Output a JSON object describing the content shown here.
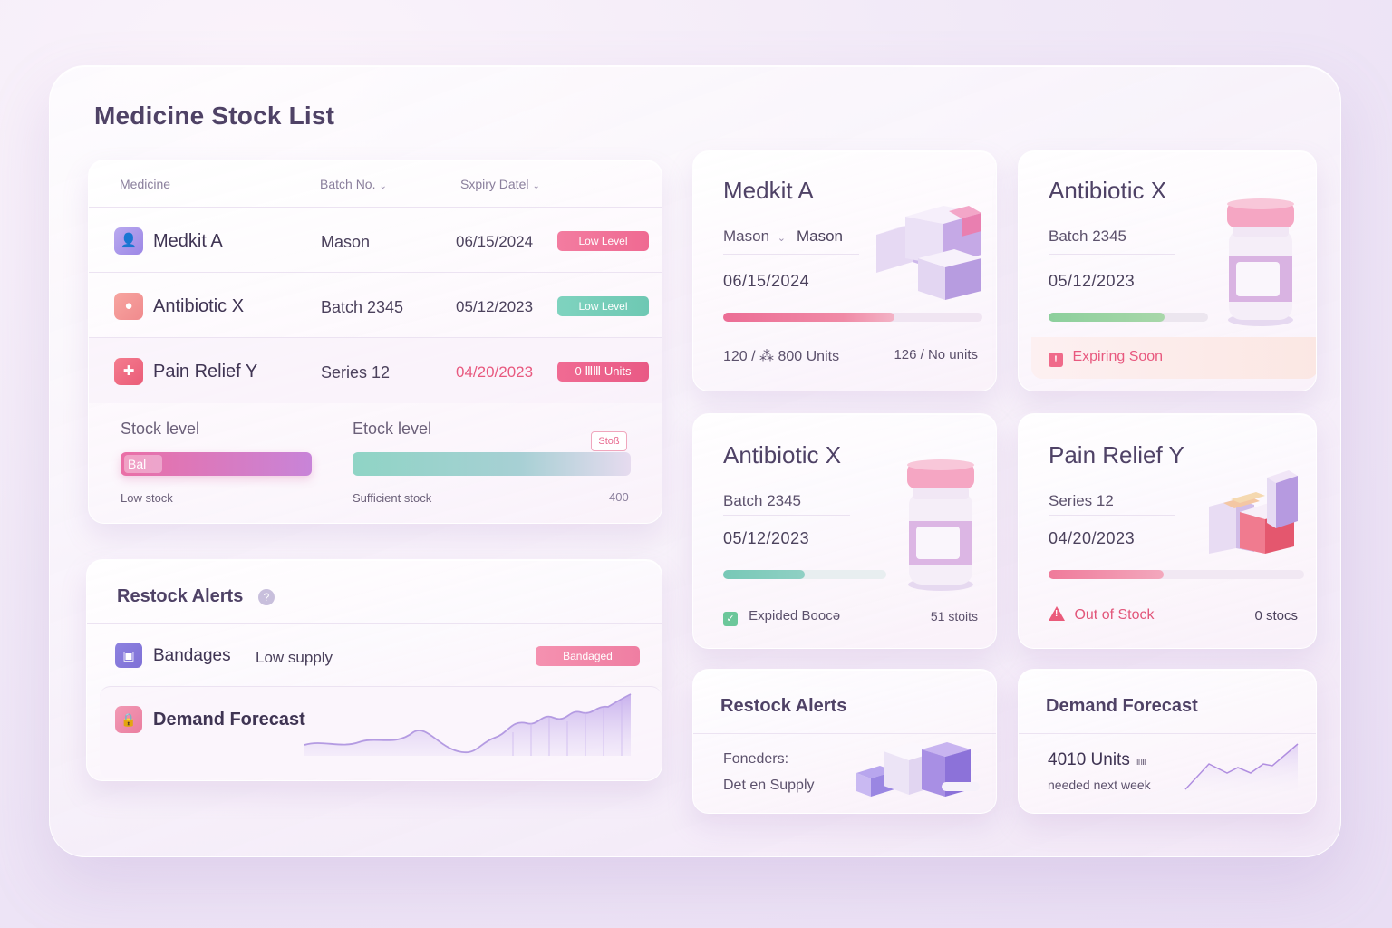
{
  "page": {
    "title": "Medicine Stock List"
  },
  "table": {
    "headers": {
      "medicine": "Medicine",
      "batch": "Batch No.",
      "expiry": "Sxpiry Datel"
    },
    "rows": [
      {
        "name": "Medkit A",
        "batch": "Mason",
        "expiry": "06/15/2024",
        "status": "Low Level",
        "status_color": "#ef6a92",
        "icon": "user-icon"
      },
      {
        "name": "Antibiotic X",
        "batch": "Batch 2345",
        "expiry": "05/12/2023",
        "status": "Low Level",
        "status_color": "#6ec8b3",
        "icon": "pill-icon"
      },
      {
        "name": "Pain Relief Y",
        "batch": "Series 12",
        "expiry": "04/20/2023",
        "status": "0 ⅢⅢ Units",
        "status_color": "#e95a85",
        "icon": "bandage-icon"
      }
    ],
    "levels": {
      "left_label": "Stock level",
      "left_tag": "Bal",
      "left_sub": "Low stock",
      "right_label": "Etock level",
      "right_tag": "Stoß",
      "right_sub": "Sufficient stock",
      "right_value": "400"
    }
  },
  "restock_left": {
    "title": "Restock Alerts",
    "row": {
      "name": "Bandages",
      "note": "Low supply",
      "pill": "Bandaged"
    },
    "forecast_title": "Demand Forecast"
  },
  "cards": {
    "medkit": {
      "title": "Medkit A",
      "field": "Mason",
      "value": "Mason",
      "date": "06/15/2024",
      "foot_left": "120 / ⁂ 800 Units",
      "foot_right": "126 / No units",
      "progress": 0.66
    },
    "antibiotic_top": {
      "title": "Antibiotic X",
      "batch": "Batch 2345",
      "date": "05/12/2023",
      "alert": "Expiring Soon",
      "progress": 0.73
    },
    "antibiotic_mid": {
      "title": "Antibiotic X",
      "batch": "Batch 2345",
      "date": "05/12/2023",
      "status": "Expided Boocə",
      "count": "51 stoits",
      "progress": 0.5
    },
    "pain_relief": {
      "title": "Pain Relief Y",
      "batch": "Series 12",
      "date": "04/20/2023",
      "status": "Out of Stock",
      "count": "0 stocs",
      "progress": 0.45
    },
    "restock": {
      "title": "Restock Alerts",
      "line1": "Foneders:",
      "line2": "Det en Supply"
    },
    "forecast": {
      "title": "Demand Forecast",
      "units": "4010 Units",
      "units_suffix": "ⅢⅢ",
      "sub": "needed next week"
    }
  },
  "colors": {
    "accent_pink": "#ef6a92",
    "accent_teal": "#6ec8b3",
    "accent_purple": "#9f86e0"
  }
}
